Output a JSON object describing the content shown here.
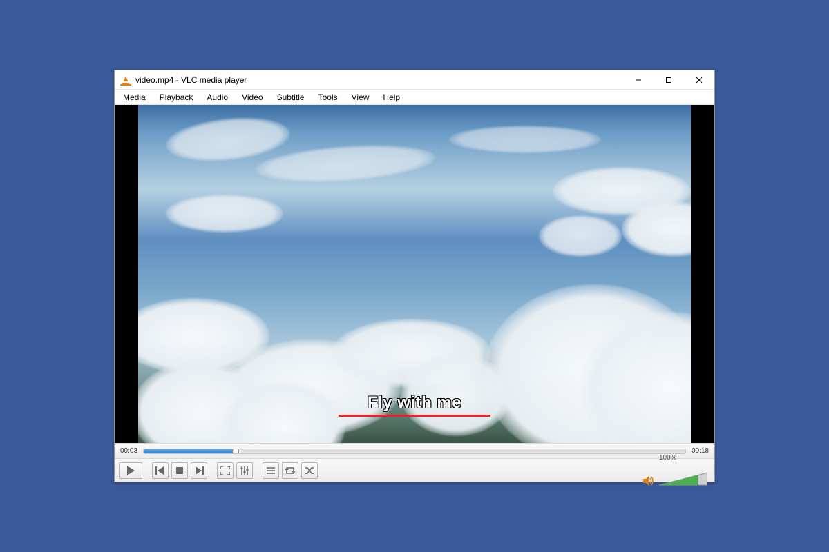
{
  "window": {
    "title": "video.mp4 - VLC media player"
  },
  "menu": {
    "items": [
      "Media",
      "Playback",
      "Audio",
      "Video",
      "Subtitle",
      "Tools",
      "View",
      "Help"
    ]
  },
  "subtitle": {
    "text": "Fly with me"
  },
  "playback": {
    "elapsed": "00:03",
    "duration": "00:18",
    "progress_percent": 17
  },
  "volume": {
    "label": "100%",
    "level_percent": 100
  },
  "icons": {
    "play": "play-icon",
    "prev": "previous-icon",
    "stop": "stop-icon",
    "next": "next-icon",
    "fullscreen": "fullscreen-icon",
    "ext": "extended-settings-icon",
    "playlist": "playlist-icon",
    "loop": "loop-icon",
    "shuffle": "shuffle-icon",
    "speaker": "speaker-icon"
  }
}
